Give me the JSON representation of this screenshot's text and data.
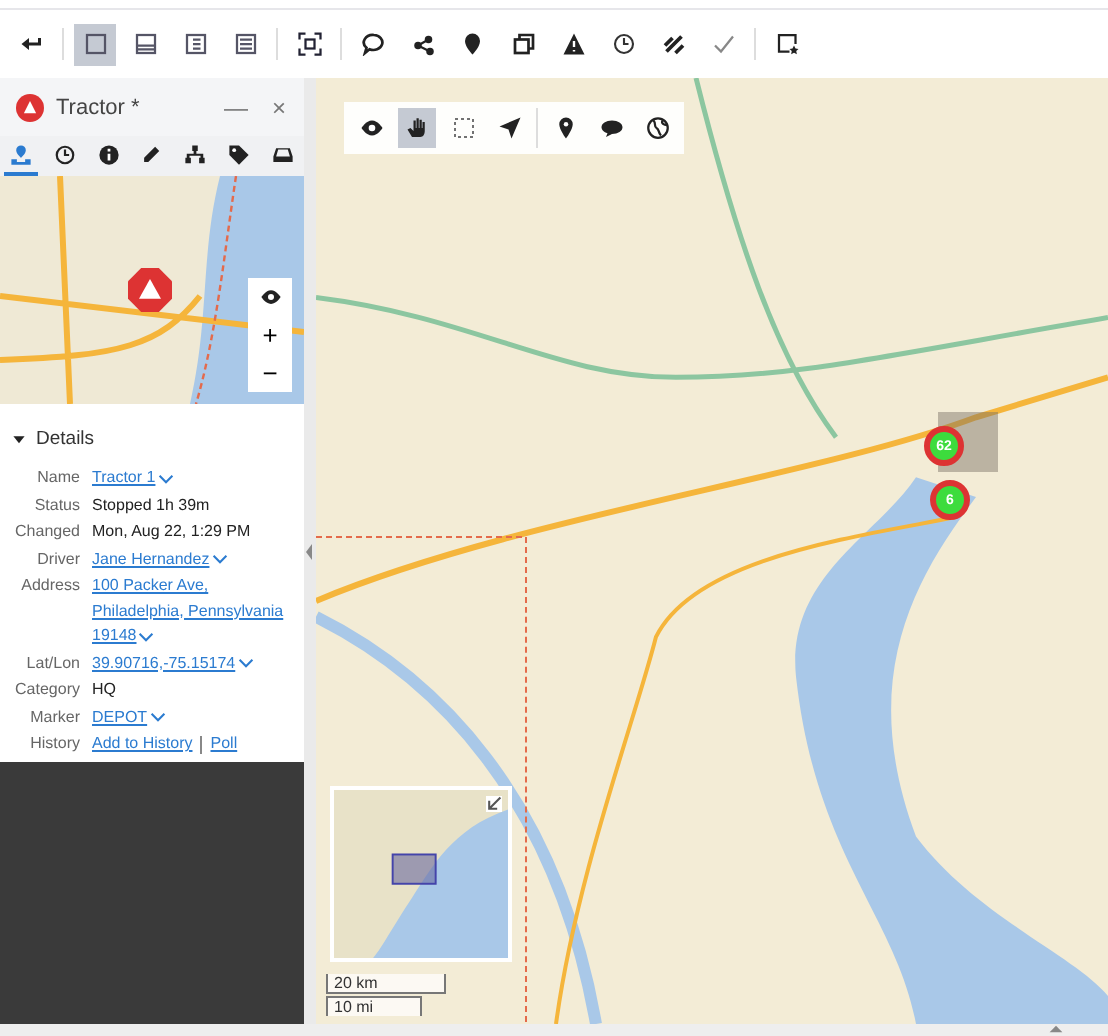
{
  "toolbar": [
    {
      "kind": "back",
      "selected": false
    },
    {
      "kind": "layout-single",
      "selected": true
    },
    {
      "kind": "layout-bottom",
      "selected": false
    },
    {
      "kind": "layout-side",
      "selected": false
    },
    {
      "kind": "layout-list",
      "selected": false
    },
    {
      "kind": "fit",
      "selected": false
    },
    {
      "kind": "chat",
      "selected": false
    },
    {
      "kind": "share",
      "selected": false
    },
    {
      "kind": "pin",
      "selected": false
    },
    {
      "kind": "copy",
      "selected": false
    },
    {
      "kind": "warning",
      "selected": false
    },
    {
      "kind": "clock",
      "selected": false
    },
    {
      "kind": "ruler",
      "selected": false
    },
    {
      "kind": "confirm",
      "selected": false
    },
    {
      "kind": "star-window",
      "selected": false
    }
  ],
  "panel": {
    "title": "Tractor *",
    "minimize": "—",
    "close": "×",
    "tabs": [
      {
        "kind": "location",
        "selected": true
      },
      {
        "kind": "clock",
        "selected": false
      },
      {
        "kind": "info",
        "selected": false
      },
      {
        "kind": "pencil",
        "selected": false
      },
      {
        "kind": "hierarchy",
        "selected": false
      },
      {
        "kind": "tag",
        "selected": false
      },
      {
        "kind": "tray",
        "selected": false
      }
    ],
    "map_controls": [
      "+",
      "−"
    ],
    "details": {
      "title": "Details",
      "expanded": true,
      "rows": [
        {
          "label": "Name",
          "kind": "link",
          "lines": [
            "Tractor 1"
          ]
        },
        {
          "label": "Status",
          "kind": "text",
          "lines": [
            "Stopped 1h 39m"
          ]
        },
        {
          "label": "Changed",
          "kind": "text",
          "lines": [
            "Mon, Aug 22, 1:29 PM"
          ]
        },
        {
          "label": "Driver",
          "kind": "link",
          "lines": [
            "Jane Hernandez"
          ]
        },
        {
          "label": "Address",
          "kind": "link",
          "lines": [
            "100 Packer Ave,",
            "Philadelphia, Pennsylvania",
            "19148"
          ]
        },
        {
          "label": "Lat/Lon",
          "kind": "link",
          "lines": [
            "39.90716,-75.15174"
          ]
        },
        {
          "label": "Category",
          "kind": "text",
          "lines": [
            "HQ"
          ]
        },
        {
          "label": "Marker",
          "kind": "link",
          "lines": [
            "DEPOT"
          ]
        },
        {
          "label": "History",
          "kind": "actions",
          "lines": [
            "Add to History",
            "Poll"
          ]
        }
      ]
    }
  },
  "map": {
    "tools": [
      {
        "kind": "eye",
        "selected": false
      },
      {
        "kind": "hand",
        "selected": true
      },
      {
        "kind": "select",
        "selected": false
      },
      {
        "kind": "navigate",
        "selected": false
      },
      {
        "kind": "pin",
        "selected": false
      },
      {
        "kind": "comment",
        "selected": false
      },
      {
        "kind": "globe",
        "selected": false
      }
    ],
    "clusters": [
      {
        "count": "62"
      },
      {
        "count": "6"
      }
    ],
    "scale": [
      "20 km",
      "10 mi"
    ]
  }
}
